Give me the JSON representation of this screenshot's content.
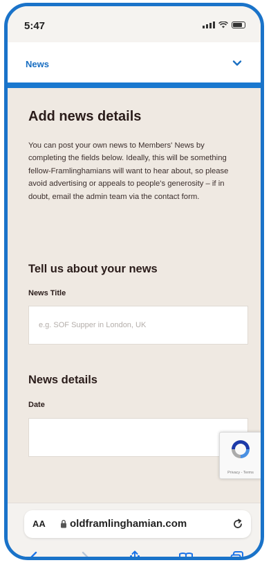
{
  "status_bar": {
    "time": "5:47"
  },
  "nav": {
    "selected": "News",
    "chevron_icon": "chevron-down-icon"
  },
  "form": {
    "heading": "Add news details",
    "intro": "You can post your own news to Members' News by completing the fields below. Ideally, this will be something fellow-Framlinghamians will want to hear about, so please avoid advertising or appeals to people's generosity – if in doubt, email the admin team via the contact form.",
    "section_news": "Tell us about your news",
    "title_label": "News Title",
    "title_placeholder": "e.g. SOF Supper in London, UK",
    "title_value": "",
    "section_details": "News details",
    "date_label": "Date",
    "date_value": ""
  },
  "recaptcha": {
    "links": "Privacy - Terms"
  },
  "browser": {
    "aa_label": "AA",
    "url": "oldframlinghamian.com",
    "toolbar_icons": [
      "back-icon",
      "forward-icon",
      "share-icon",
      "bookmarks-icon",
      "tabs-icon"
    ]
  },
  "colors": {
    "accent": "#1a78cf",
    "link": "#1a6fc2",
    "background": "#efe9e2",
    "heading": "#2a1c1a"
  }
}
